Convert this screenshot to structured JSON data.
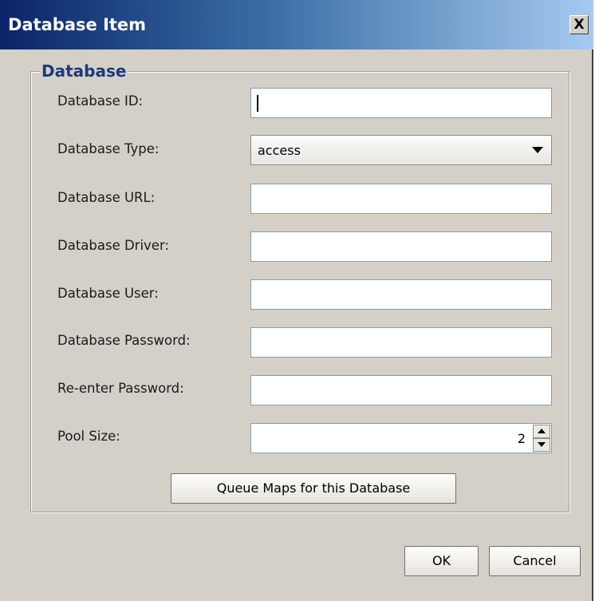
{
  "window": {
    "title": "Database Item",
    "close_glyph": "X"
  },
  "group": {
    "legend": "Database"
  },
  "fields": {
    "database_id": {
      "label": "Database ID:",
      "value": ""
    },
    "database_type": {
      "label": "Database Type:",
      "selected": "access"
    },
    "database_url": {
      "label": "Database URL:",
      "value": ""
    },
    "database_driver": {
      "label": "Database Driver:",
      "value": ""
    },
    "database_user": {
      "label": "Database User:",
      "value": ""
    },
    "database_password": {
      "label": "Database Password:",
      "value": ""
    },
    "reenter_password": {
      "label": "Re-enter Password:",
      "value": ""
    },
    "pool_size": {
      "label": "Pool Size:",
      "value": "2"
    }
  },
  "buttons": {
    "queue_maps": "Queue Maps for this Database",
    "ok": "OK",
    "cancel": "Cancel"
  },
  "icons": {
    "close": "close-icon",
    "dropdown": "chevron-down-icon",
    "spin_up": "arrow-up-icon",
    "spin_down": "arrow-down-icon"
  },
  "colors": {
    "titlebar_start": "#0a246a",
    "titlebar_end": "#a6caf0",
    "dialog_background": "#d4d0c8",
    "legend_text": "#1c3a7e"
  }
}
